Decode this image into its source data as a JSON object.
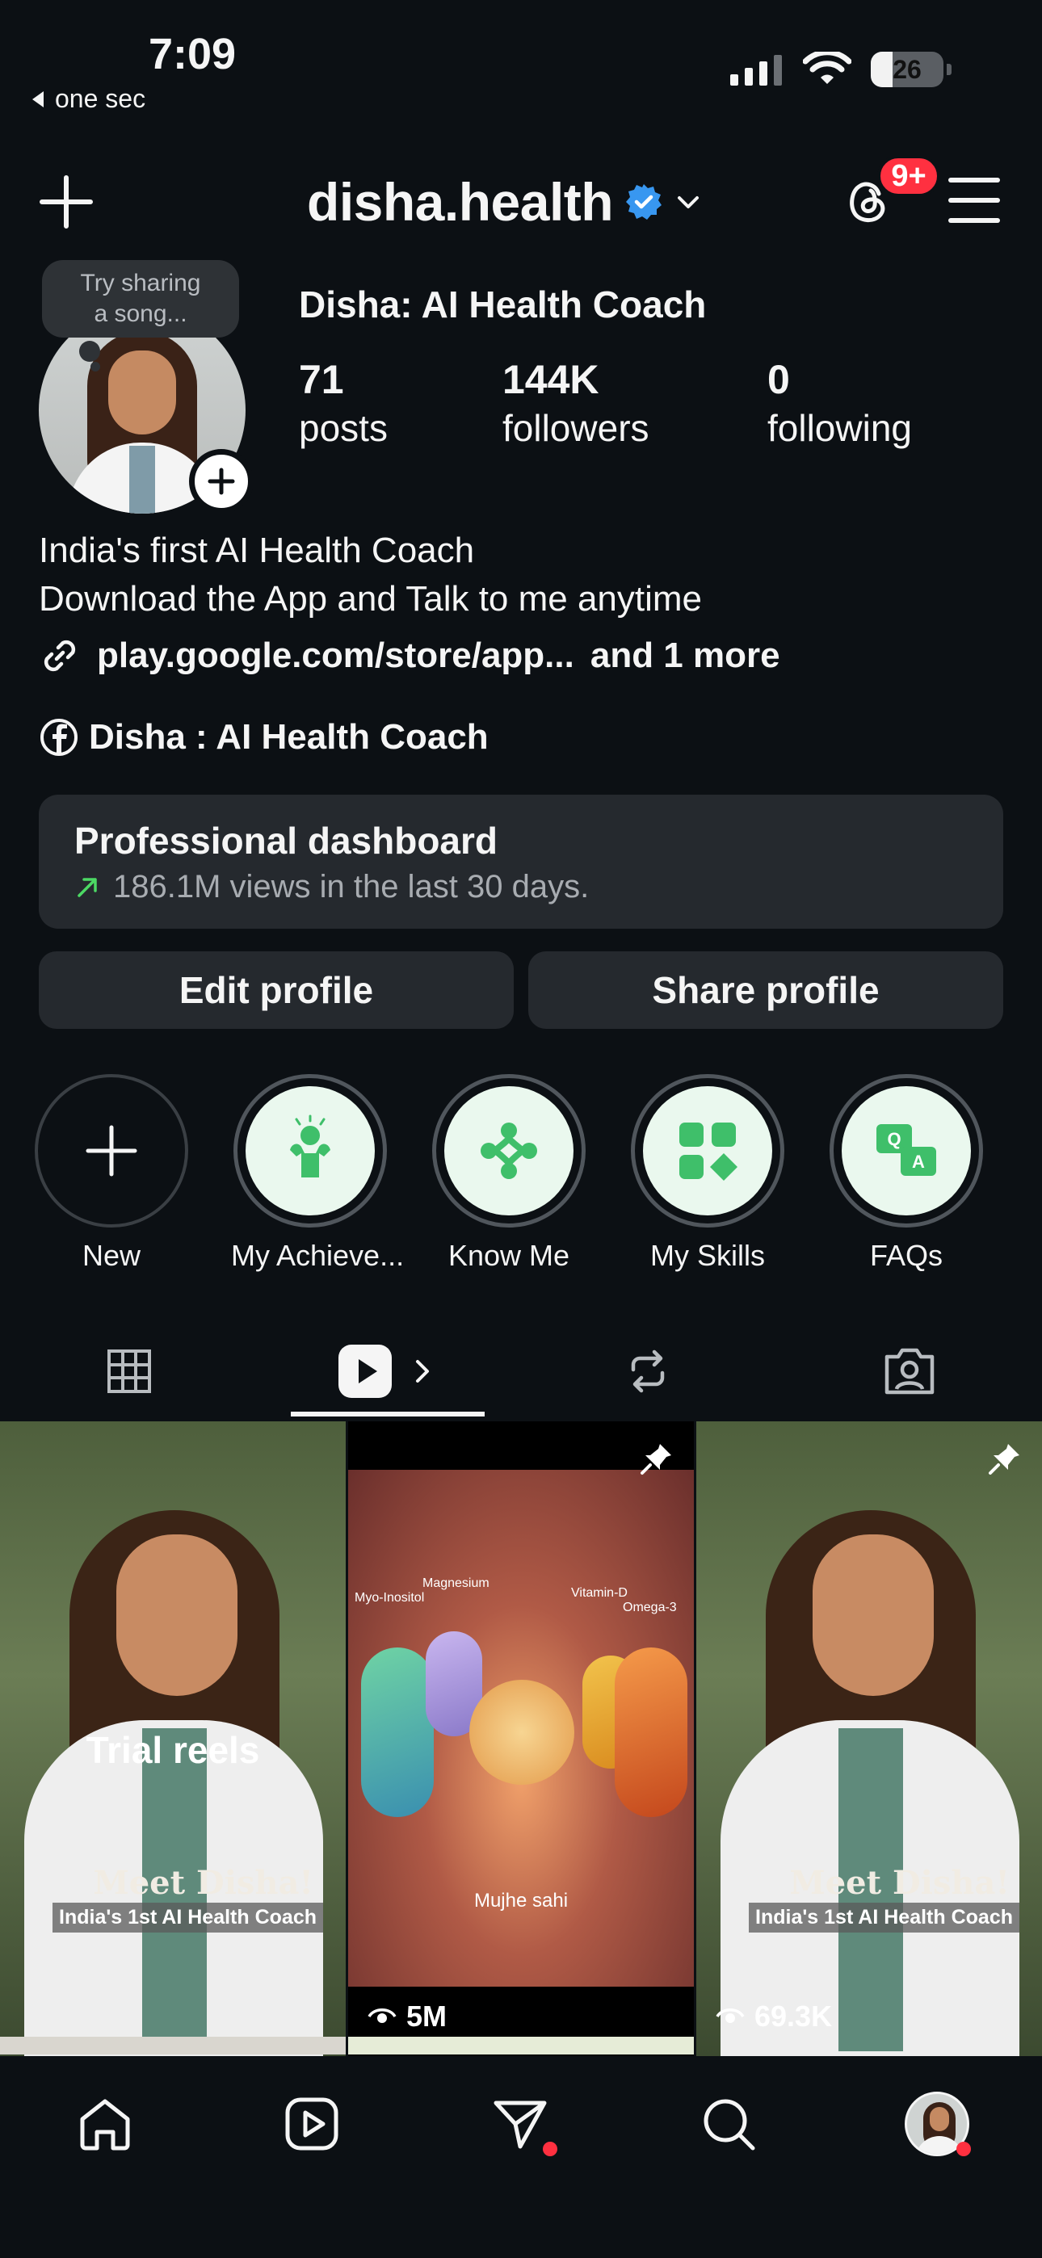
{
  "status_bar": {
    "time": "7:09",
    "back_app": "one sec",
    "battery": "26"
  },
  "header": {
    "username": "disha.health",
    "notifications_badge": "9+"
  },
  "profile": {
    "note": [
      "Try sharing",
      "a song..."
    ],
    "display_name": "Disha: AI Health Coach",
    "stats": [
      {
        "value": "71",
        "label": "posts"
      },
      {
        "value": "144K",
        "label": "followers"
      },
      {
        "value": "0",
        "label": "following"
      }
    ],
    "bio": [
      "India's first AI Health Coach",
      "Download the App and Talk to me anytime"
    ],
    "link_text": "play.google.com/store/app...",
    "link_more": "and 1 more",
    "facebook_page": "Disha : AI Health Coach"
  },
  "dashboard": {
    "title": "Professional dashboard",
    "subtitle": "186.1M views in the last 30 days."
  },
  "buttons": {
    "edit": "Edit profile",
    "share": "Share profile"
  },
  "highlights": [
    {
      "label": "New"
    },
    {
      "label": "My Achieve..."
    },
    {
      "label": "Know Me"
    },
    {
      "label": "My Skills"
    },
    {
      "label": "FAQs"
    }
  ],
  "grid": {
    "items": [
      {
        "overlay": "Trial reels",
        "title": "Meet Disha!",
        "subtitle": "India's 1st AI Health Coach"
      },
      {
        "views": "5M",
        "labels": [
          "Magnesium",
          "Myo-Inositol",
          "Vitamin-D",
          "Omega-3"
        ],
        "caption": "Mujhe sahi"
      },
      {
        "views": "69.3K",
        "title": "Meet Disha!",
        "subtitle": "India's 1st AI Health Coach"
      }
    ]
  },
  "colors": {
    "background": "#0c1014",
    "surface": "#25292e",
    "badge_red": "#ff3040",
    "verified_blue": "#3897f0",
    "trend_green": "#4cd964",
    "highlight_green": "#3fbf6a"
  }
}
